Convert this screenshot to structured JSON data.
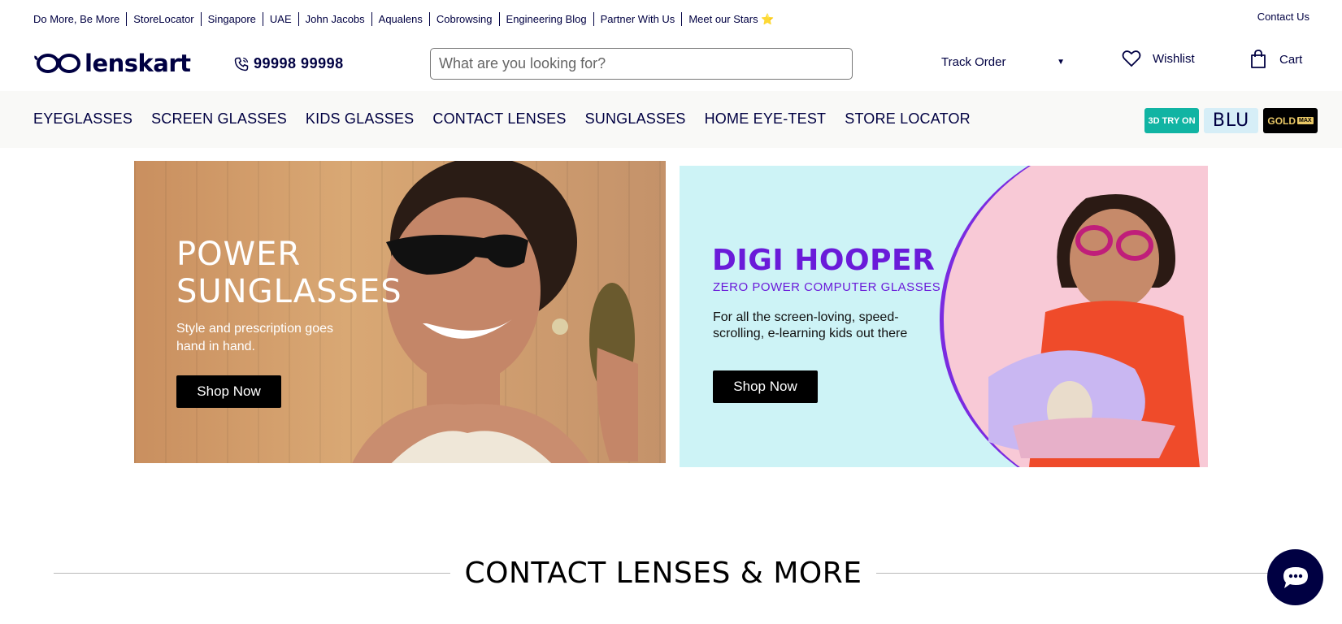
{
  "topbar": {
    "links": [
      "Do More, Be More",
      "StoreLocator",
      "Singapore",
      "UAE",
      "John Jacobs",
      "Aqualens",
      "Cobrowsing",
      "Engineering Blog",
      "Partner With Us",
      "Meet our Stars ⭐"
    ],
    "contact": "Contact Us"
  },
  "header": {
    "logo_text": "lenskart",
    "phone": "99998 99998",
    "search_placeholder": "What are you looking for?",
    "track_order": "Track Order",
    "wishlist": "Wishlist",
    "cart": "Cart"
  },
  "nav": {
    "items": [
      "EYEGLASSES",
      "SCREEN GLASSES",
      "KIDS GLASSES",
      "CONTACT LENSES",
      "SUNGLASSES",
      "HOME EYE-TEST",
      "STORE LOCATOR"
    ],
    "badges": {
      "try_on": "3D TRY ON",
      "blu": "BLU",
      "gold": "GOLD",
      "gold_max": "MAX"
    }
  },
  "banners": {
    "left": {
      "title_line1": "POWER",
      "title_line2": "SUNGLASSES",
      "subtitle_line1": "Style and prescription goes",
      "subtitle_line2": "hand in hand.",
      "button": "Shop Now"
    },
    "right": {
      "title": "DIGI HOOPER",
      "subtitle": "ZERO POWER COMPUTER GLASSES",
      "desc_line1": "For all the screen-loving, speed-",
      "desc_line2": "scrolling, e-learning kids out there",
      "button": "Shop Now"
    }
  },
  "section": {
    "heading": "CONTACT LENSES & MORE"
  },
  "colors": {
    "brand": "#000042",
    "teal": "#11b4a3",
    "purple": "#6a1bd9"
  }
}
